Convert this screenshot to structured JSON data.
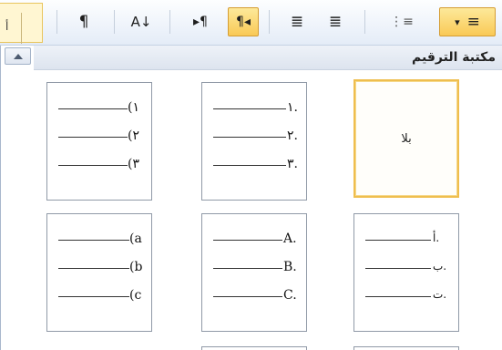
{
  "toolbar": {
    "clipped_label": "أ",
    "buttons": [
      {
        "name": "show-formatting-marks-button",
        "icon": "pilcrow-icon",
        "glyph": "¶"
      },
      {
        "name": "sort-button",
        "icon": "sort-az-icon",
        "glyph": "A↓"
      },
      {
        "name": "ltr-direction-button",
        "icon": "ltr-paragraph-icon",
        "glyph": "▸¶"
      },
      {
        "name": "rtl-direction-button",
        "icon": "rtl-paragraph-icon",
        "glyph": "¶◂",
        "active": true
      },
      {
        "name": "increase-indent-button",
        "icon": "increase-indent-icon",
        "glyph": "≣"
      },
      {
        "name": "decrease-indent-button",
        "icon": "decrease-indent-icon",
        "glyph": "≣"
      },
      {
        "name": "multilevel-list-button",
        "icon": "multilevel-list-icon",
        "glyph": "⋮≡"
      },
      {
        "name": "numbering-button",
        "icon": "numbering-icon",
        "glyph": "≡",
        "active": true
      }
    ]
  },
  "gallery": {
    "title": "مكتبة الترقيم",
    "none_label": "بلا",
    "cells": [
      {
        "name": "numbering-none",
        "labels": []
      },
      {
        "name": "numbering-arabic-dot",
        "labels": [
          "١.",
          "٢.",
          "٣."
        ]
      },
      {
        "name": "numbering-arabic-paren",
        "labels": [
          "(١",
          "(٢",
          "(٣"
        ]
      },
      {
        "name": "numbering-arabic-letters",
        "labels": [
          "أ.",
          "ب.",
          "ت."
        ]
      },
      {
        "name": "numbering-upper-latin",
        "labels": [
          "A.",
          "B.",
          "C."
        ]
      },
      {
        "name": "numbering-lower-latin-paren",
        "labels": [
          "(a",
          "(b",
          "(c"
        ]
      }
    ]
  },
  "colors": {
    "accent": "#f9c956",
    "selected_border": "#efbe4e",
    "header_bg": "#dde4ef"
  }
}
